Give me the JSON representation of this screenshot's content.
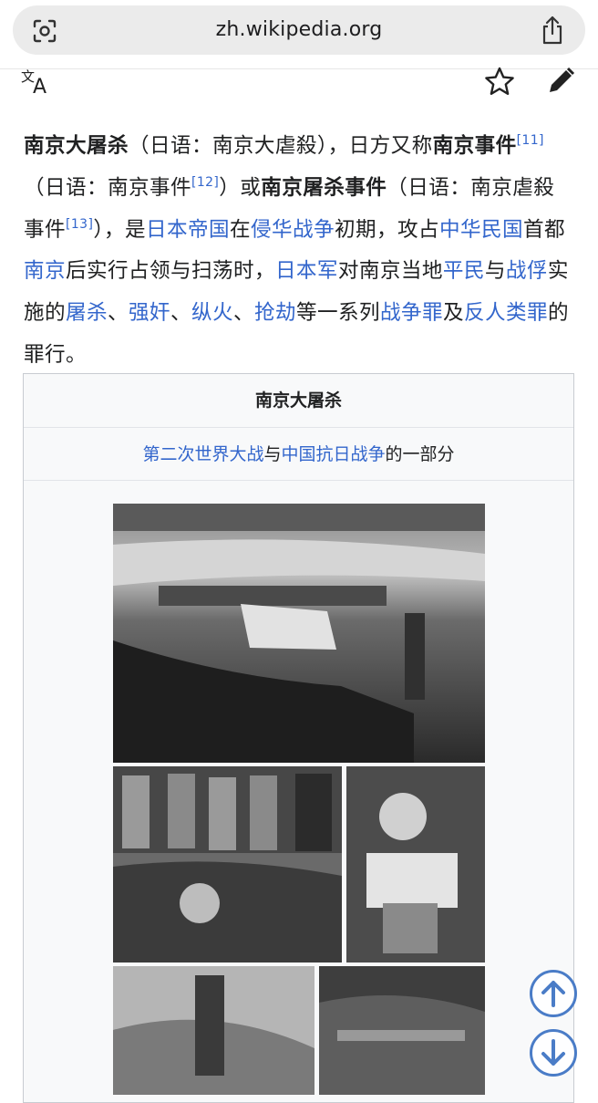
{
  "browser": {
    "url": "zh.wikipedia.org"
  },
  "icons": {
    "lens": "visual-lookup-icon",
    "share": "share-icon",
    "language": "language-icon",
    "watch": "star-icon",
    "edit": "pencil-icon",
    "scroll_up": "arrow-up-circle-icon",
    "scroll_down": "arrow-down-circle-icon"
  },
  "lead": {
    "l1_bold": "南京大屠杀",
    "l1_rest": "（日语：南京大虐殺），日方又称",
    "l1_bold2": "南京事",
    "l2_bold": "件",
    "l2_ref1": "[11]",
    "l2_t1": "（日语：南京事件",
    "l2_ref2": "[12]",
    "l2_t2": "）或",
    "l2_bold2": "南京屠杀事件",
    "l2_t3": "（日语：",
    "l3_t1": "南京虐殺事件",
    "l3_ref": "[13]",
    "l3_t2": "），是",
    "l3_link1": "日本帝国",
    "l3_t3": "在",
    "l3_link2": "侵华战争",
    "l3_t4": "初期，攻",
    "l4_t1": "占",
    "l4_link1": "中华民国",
    "l4_t2": "首都",
    "l4_link2": "南京",
    "l4_t3": "后实行占领与扫荡时，",
    "l4_link3": "日本军",
    "l4_t4": "对",
    "l5_t1": "南京当地",
    "l5_link1": "平民",
    "l5_t2": "与",
    "l5_link2": "战俘",
    "l5_t3": "实施的",
    "l5_link3": "屠杀",
    "l5_t4": "、",
    "l5_link4": "强奸",
    "l5_t5": "、",
    "l5_link5": "纵火",
    "l5_t6": "、",
    "l5_link6": "抢劫",
    "l6_t1": "等一系列",
    "l6_link1": "战争罪",
    "l6_t2": "及",
    "l6_link2": "反人类罪",
    "l6_t3": "的罪行。"
  },
  "infobox": {
    "title": "南京大屠杀",
    "sub_link1": "第二次世界大战",
    "sub_t1": "与",
    "sub_link2": "中国抗日战争",
    "sub_t2": "的一部分"
  },
  "colors": {
    "link": "#3366cc",
    "text": "#202122",
    "infobox_bg": "#f8f9fa",
    "infobox_border": "#c8ccd1",
    "fab": "#4a7cc7"
  }
}
